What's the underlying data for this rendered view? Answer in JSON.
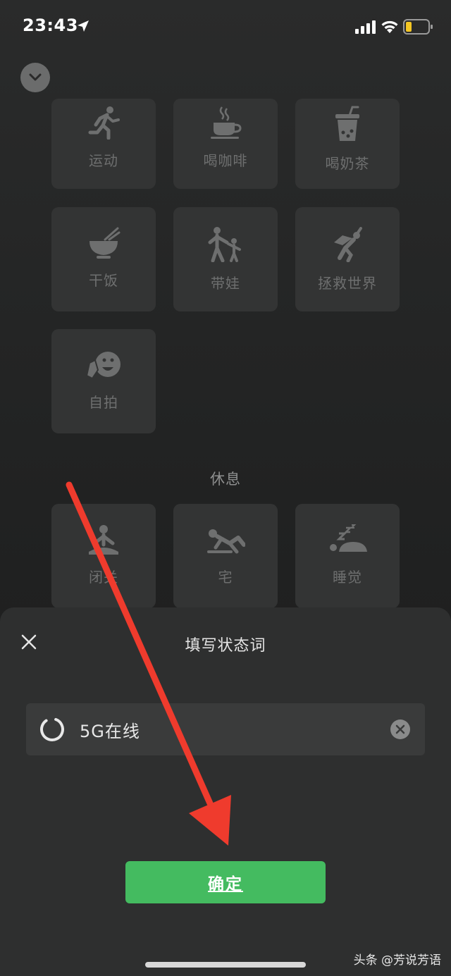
{
  "status_bar": {
    "time": "23:43",
    "icons": [
      "location-arrow-icon",
      "cellular-signal-icon",
      "wifi-icon",
      "battery-low-icon"
    ]
  },
  "colors": {
    "accent_green": "#44bb60",
    "arrow_red": "#ef3b2d",
    "tile_bg": "#333434",
    "sheet_bg": "#2e2f2f"
  },
  "tiles": {
    "exercise": {
      "label": "运动",
      "icon": "running-icon"
    },
    "coffee": {
      "label": "喝咖啡",
      "icon": "coffee-cup-icon"
    },
    "milk_tea": {
      "label": "喝奶茶",
      "icon": "bubble-tea-icon"
    },
    "eat": {
      "label": "干饭",
      "icon": "rice-bowl-icon"
    },
    "childcare": {
      "label": "带娃",
      "icon": "parent-child-icon"
    },
    "save_world": {
      "label": "拯救世界",
      "icon": "superhero-icon"
    },
    "selfie": {
      "label": "自拍",
      "icon": "selfie-face-icon"
    },
    "meditate": {
      "label": "闭关",
      "icon": "meditation-icon"
    },
    "stay_home": {
      "label": "宅",
      "icon": "lounging-icon"
    },
    "sleep": {
      "label": "睡觉",
      "icon": "sleeping-icon"
    }
  },
  "sections": {
    "rest_title": "休息"
  },
  "sheet": {
    "title": "填写状态词",
    "input_value": "5G在线",
    "confirm_label": "确定"
  },
  "watermark": "头条 @芳说芳语"
}
